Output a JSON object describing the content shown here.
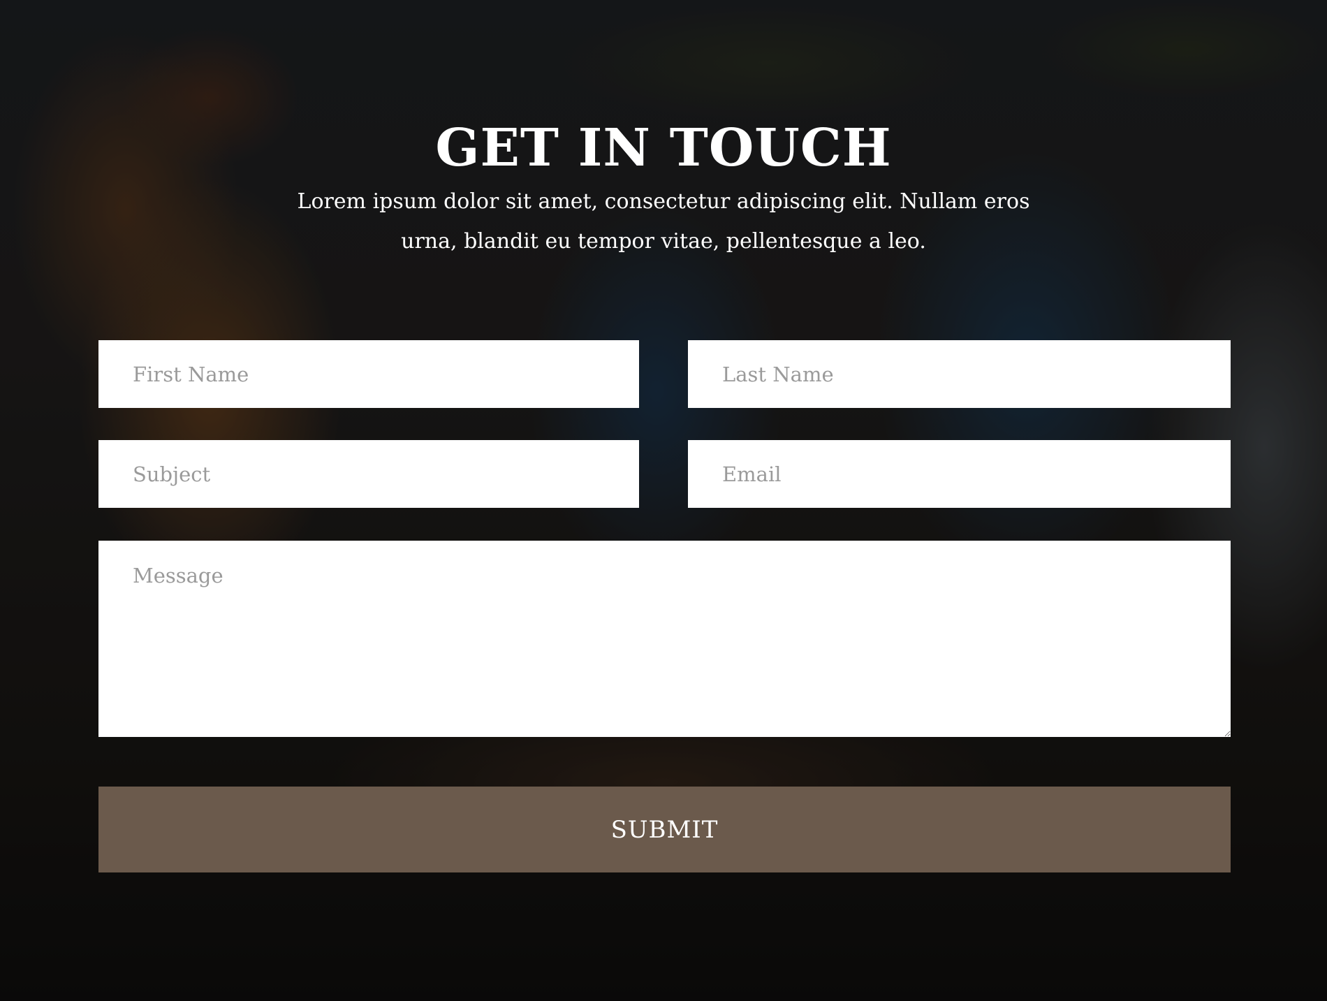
{
  "contact": {
    "title": "GET IN TOUCH",
    "subtitle": "Lorem ipsum dolor sit amet, consectetur adipiscing elit. Nullam eros urna, blandit eu tempor vitae, pellentesque a leo."
  },
  "form": {
    "first_name_placeholder": "First Name",
    "last_name_placeholder": "Last Name",
    "subject_placeholder": "Subject",
    "email_placeholder": "Email",
    "message_placeholder": "Message",
    "submit_label": "SUBMIT"
  },
  "colors": {
    "submit_button": "#6b5a4c",
    "field_background": "#ffffff",
    "text": "#ffffff"
  }
}
